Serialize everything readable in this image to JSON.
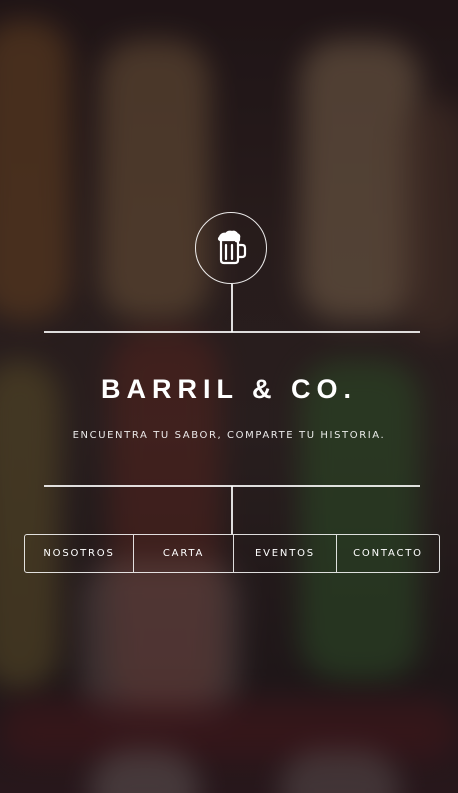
{
  "brand": {
    "title": "BARRIL & CO.",
    "tagline": "ENCUENTRA TU SABOR, COMPARTE TU HISTORIA."
  },
  "icons": {
    "logo": "beer-mug-icon"
  },
  "nav": {
    "items": [
      {
        "label": "NOSOTROS"
      },
      {
        "label": "CARTA"
      },
      {
        "label": "EVENTOS"
      },
      {
        "label": "CONTACTO"
      }
    ]
  },
  "colors": {
    "line": "#ffffff",
    "text": "#ffffff",
    "background": "#1e1618"
  }
}
